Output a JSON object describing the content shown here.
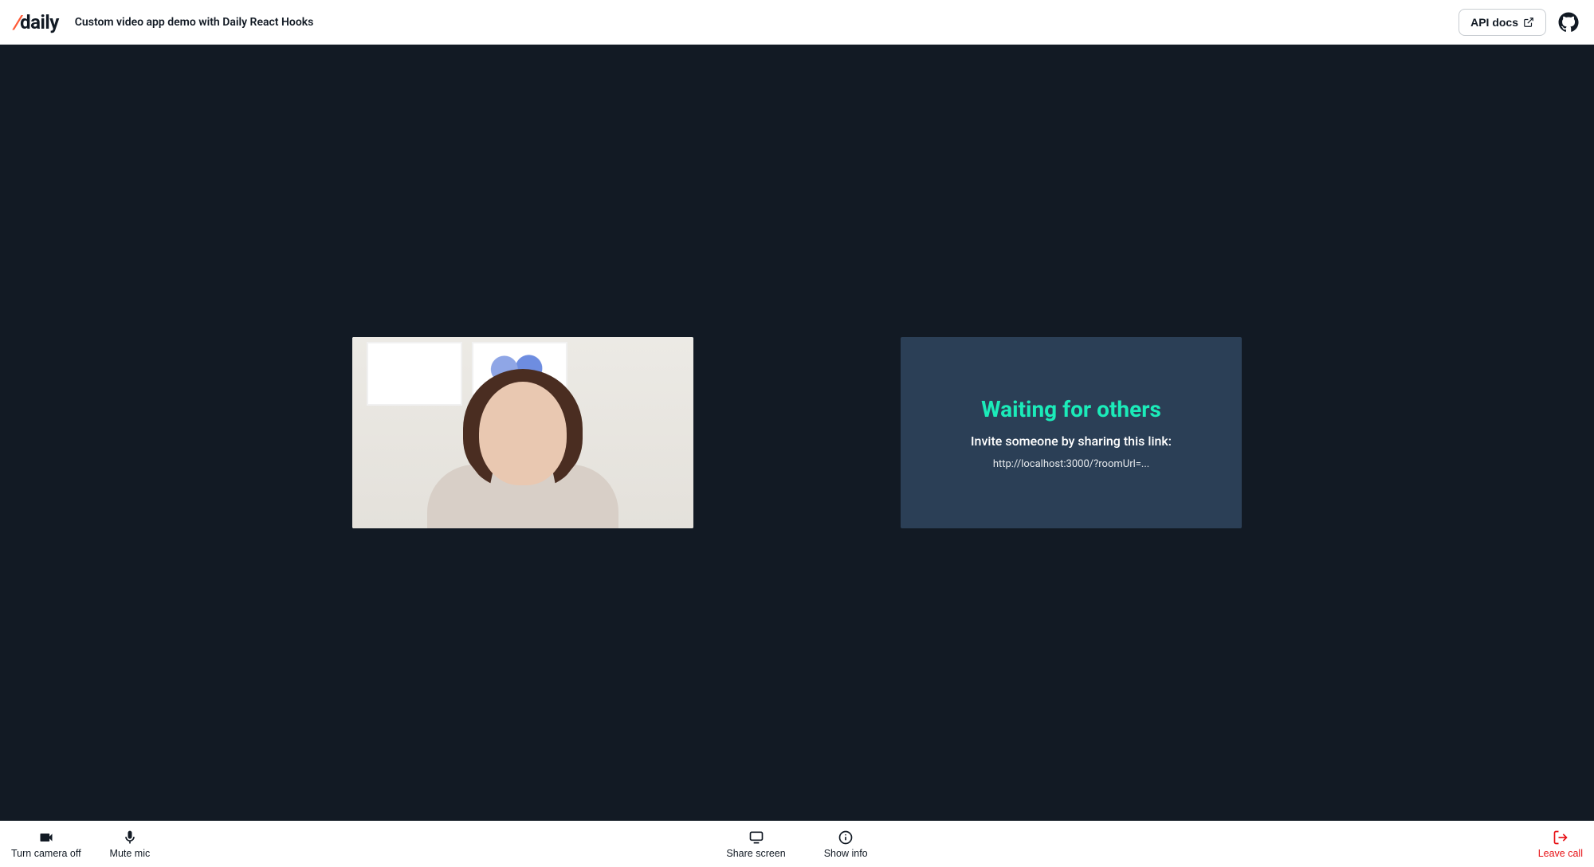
{
  "header": {
    "logo_text": "daily",
    "title": "Custom video app demo with Daily React Hooks",
    "api_docs_label": "API docs"
  },
  "waiting": {
    "title": "Waiting for others",
    "subtitle": "Invite someone by sharing this link:",
    "link": "http://localhost:3000/?roomUrl=..."
  },
  "tray": {
    "camera_label": "Turn camera off",
    "mic_label": "Mute mic",
    "share_label": "Share screen",
    "info_label": "Show info",
    "leave_label": "Leave call"
  }
}
